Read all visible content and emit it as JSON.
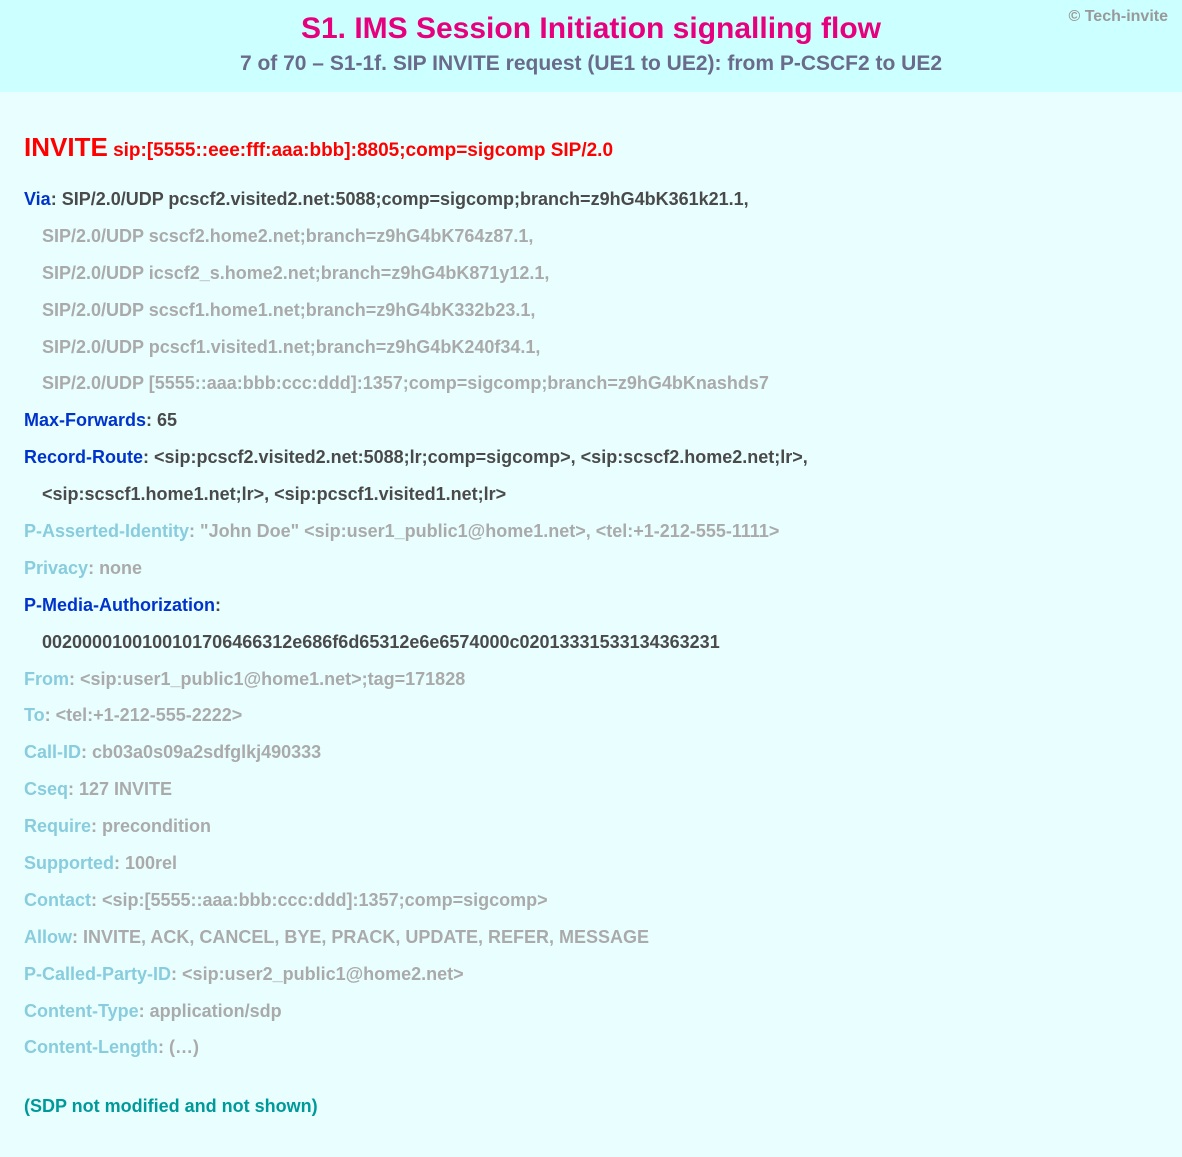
{
  "copyright": "© Tech-invite",
  "title": "S1. IMS Session Initiation signalling flow",
  "subtitle": "7 of 70 – S1-1f. SIP INVITE request (UE1 to UE2): from P-CSCF2 to UE2",
  "method": "INVITE",
  "request_uri": " sip:[5555::eee:fff:aaa:bbb]:8805;comp=sigcomp SIP/2.0",
  "headers": [
    {
      "name": "Via",
      "style": "dark",
      "inlineValue": "SIP/2.0/UDP pcscf2.visited2.net:5088;comp=sigcomp;branch=z9hG4bK361k21.1,",
      "cont": [
        {
          "text": "SIP/2.0/UDP scscf2.home2.net;branch=z9hG4bK764z87.1,",
          "style": "light"
        },
        {
          "text": "SIP/2.0/UDP icscf2_s.home2.net;branch=z9hG4bK871y12.1,",
          "style": "light"
        },
        {
          "text": "SIP/2.0/UDP scscf1.home1.net;branch=z9hG4bK332b23.1,",
          "style": "light"
        },
        {
          "text": "SIP/2.0/UDP pcscf1.visited1.net;branch=z9hG4bK240f34.1,",
          "style": "light"
        },
        {
          "text": "SIP/2.0/UDP [5555::aaa:bbb:ccc:ddd]:1357;comp=sigcomp;branch=z9hG4bKnashds7",
          "style": "light"
        }
      ]
    },
    {
      "name": "Max-Forwards",
      "style": "dark",
      "inlineValue": "65"
    },
    {
      "name": "Record-Route",
      "style": "dark",
      "inlineValue": "<sip:pcscf2.visited2.net:5088;lr;comp=sigcomp>, <sip:scscf2.home2.net;lr>,",
      "cont": [
        {
          "text": "<sip:scscf1.home1.net;lr>, <sip:pcscf1.visited1.net;lr>",
          "style": "dark"
        }
      ]
    },
    {
      "name": "P-Asserted-Identity",
      "style": "light",
      "inlineValue": "\"John Doe\" <sip:user1_public1@home1.net>, <tel:+1-212-555-1111>"
    },
    {
      "name": "Privacy",
      "style": "light",
      "inlineValue": "none"
    },
    {
      "name": "P-Media-Authorization",
      "style": "dark",
      "inlineValue": "",
      "cont": [
        {
          "text": "0020000100100101706466312e686f6d65312e6e6574000c020133315331343632​31",
          "style": "dark"
        }
      ]
    },
    {
      "name": "From",
      "style": "light",
      "inlineValue": "<sip:user1_public1@home1.net>;tag=171828"
    },
    {
      "name": "To",
      "style": "light",
      "inlineValue": "<tel:+1-212-555-2222>"
    },
    {
      "name": "Call-ID",
      "style": "light",
      "inlineValue": "cb03a0s09a2sdfglkj490333"
    },
    {
      "name": "Cseq",
      "style": "light",
      "inlineValue": "127 INVITE"
    },
    {
      "name": "Require",
      "style": "light",
      "inlineValue": "precondition"
    },
    {
      "name": "Supported",
      "style": "light",
      "inlineValue": "100rel"
    },
    {
      "name": "Contact",
      "style": "light",
      "inlineValue": "<sip:[5555::aaa:bbb:ccc:ddd]:1357;comp=sigcomp>"
    },
    {
      "name": "Allow",
      "style": "light",
      "inlineValue": "INVITE, ACK, CANCEL, BYE, PRACK, UPDATE, REFER, MESSAGE"
    },
    {
      "name": "P-Called-Party-ID",
      "style": "light",
      "inlineValue": "<sip:user2_public1@home2.net>"
    },
    {
      "name": "Content-Type",
      "style": "light",
      "inlineValue": "application/sdp"
    },
    {
      "name": "Content-Length",
      "style": "light",
      "inlineValue": "(…)"
    }
  ],
  "sdp_note": "(SDP not modified and not shown)"
}
